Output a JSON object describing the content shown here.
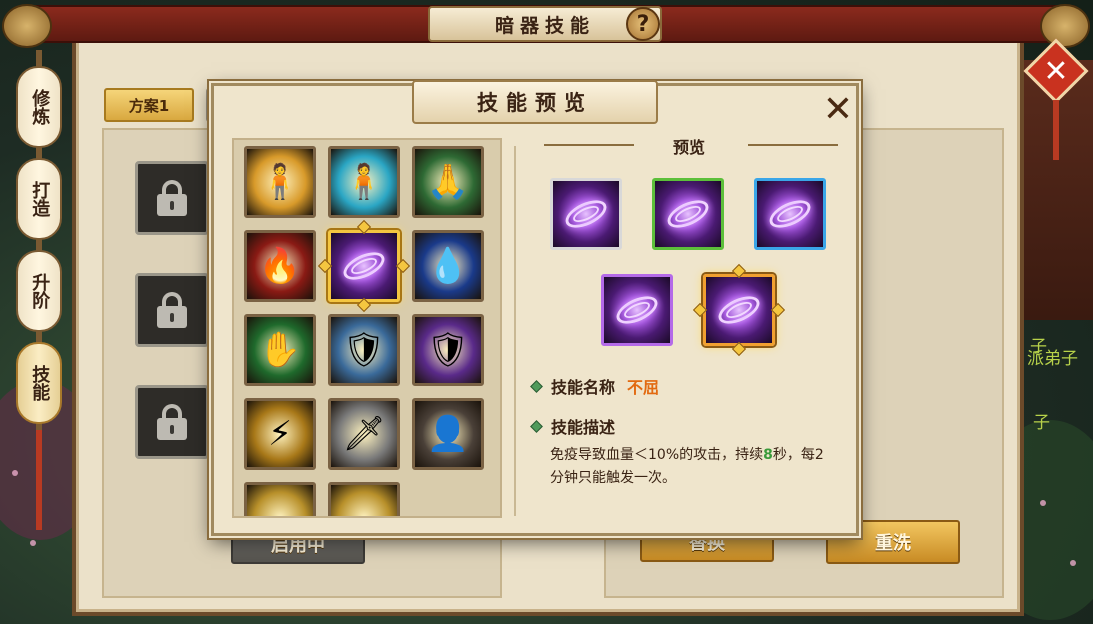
{
  "window": {
    "title": "暗器技能",
    "help_label": "?",
    "close_label": "✕"
  },
  "side_tabs": [
    {
      "label": "修炼"
    },
    {
      "label": "打造"
    },
    {
      "label": "升阶"
    },
    {
      "label": "技能",
      "active": true
    }
  ],
  "plan_tabs": [
    {
      "label": "方案1",
      "active": true
    },
    {
      "label": ""
    },
    {
      "label": ""
    },
    {
      "label": ""
    }
  ],
  "background_text": {
    "line1": "子",
    "line2": "派弟子",
    "line3": "子"
  },
  "buttons": {
    "in_use": "启用中",
    "replace": "替换",
    "reroll": "重洗"
  },
  "modal": {
    "title": "技能预览",
    "close_label": "✕",
    "preview_heading": "预览",
    "skill_name_label": "技能名称",
    "skill_name_value": "不屈",
    "skill_desc_label": "技能描述",
    "skill_desc_prefix": "免疫导致血量＜10%的攻击，持续",
    "skill_desc_duration": "8",
    "skill_desc_suffix": "秒，每2分钟只能触发一次。"
  },
  "skill_grid": [
    {
      "icon": "golden-aura-figure-icon",
      "glyph": "🧍",
      "bg": "#d89a2a"
    },
    {
      "icon": "cyan-aura-figure-icon",
      "glyph": "🧍",
      "bg": "#2aa6c4"
    },
    {
      "icon": "praying-hands-icon",
      "glyph": "🙏",
      "bg": "#2e6a34"
    },
    {
      "icon": "red-flame-hand-icon",
      "glyph": "🔥",
      "bg": "#8a1a14"
    },
    {
      "icon": "purple-rune-disc-icon",
      "glyph": "",
      "bg": "#4a1a72",
      "selected": true
    },
    {
      "icon": "blue-flame-hand-icon",
      "glyph": "💧",
      "bg": "#1a3a8a"
    },
    {
      "icon": "green-flame-hand-icon",
      "glyph": "✋",
      "bg": "#1f6a2c"
    },
    {
      "icon": "ice-shield-icon",
      "glyph": "🛡",
      "bg": "#3a6a9a"
    },
    {
      "icon": "purple-armor-icon",
      "glyph": "🛡",
      "bg": "#5a2a8a"
    },
    {
      "icon": "golden-dash-warrior-icon",
      "glyph": "⚡",
      "bg": "#a87818"
    },
    {
      "icon": "silver-blades-icon",
      "glyph": "🗡",
      "bg": "#7a7a7a"
    },
    {
      "icon": "shadow-strike-icon",
      "glyph": "👤",
      "bg": "#4a4038"
    },
    {
      "icon": "golden-partial-icon-1",
      "glyph": "",
      "bg": "#b8902a"
    },
    {
      "icon": "golden-partial-icon-2",
      "glyph": "",
      "bg": "#b8902a"
    }
  ],
  "preview_icons": [
    {
      "frame": "#d8d8d8"
    },
    {
      "frame": "#5cbf3a"
    },
    {
      "frame": "#3aa6e8"
    },
    {
      "frame": "#b46ae8"
    },
    {
      "frame": "#f0a030",
      "selected": true
    }
  ]
}
